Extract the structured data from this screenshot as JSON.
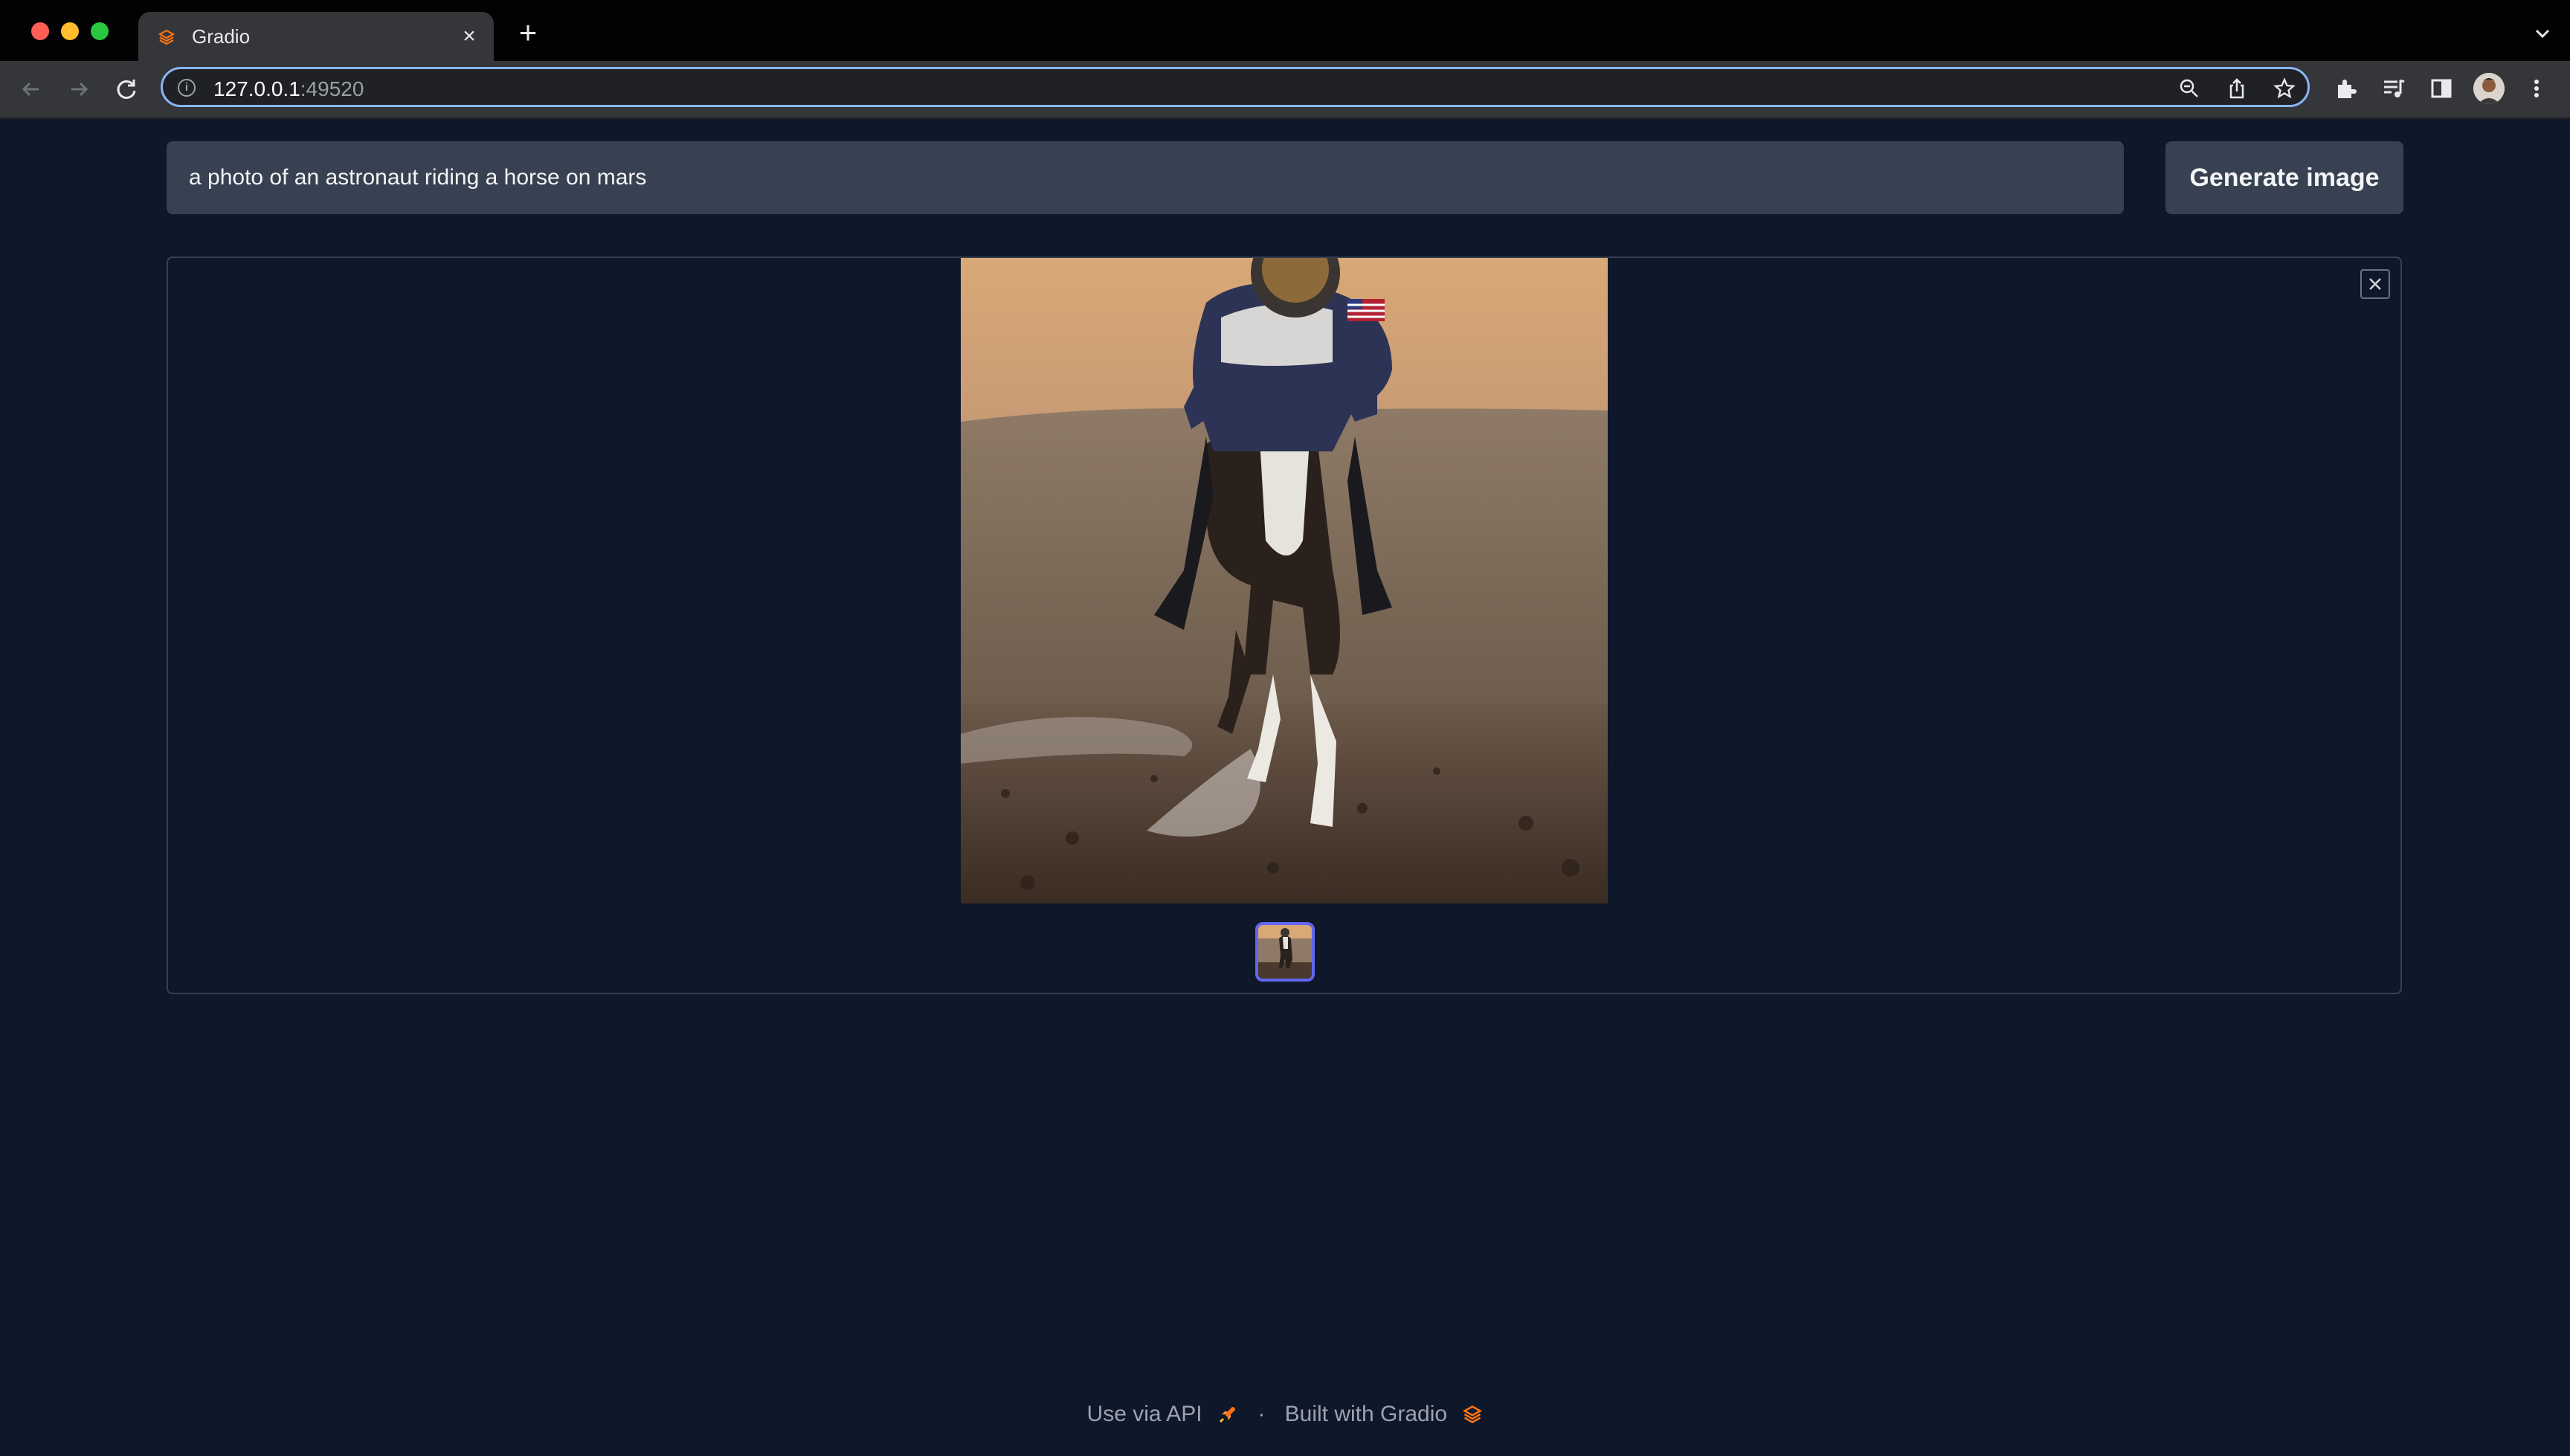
{
  "browser": {
    "tab_title": "Gradio",
    "url_host": "127.0.0.1",
    "url_port": ":49520"
  },
  "app": {
    "prompt_value": "a photo of an astronaut riding a horse on mars",
    "generate_label": "Generate image",
    "gallery": {
      "selected_index": 0,
      "image_count": 1,
      "image_subject": "astronaut riding a horse on mars"
    }
  },
  "footer": {
    "api_label": "Use via API",
    "separator": "·",
    "built_label": "Built with Gradio"
  },
  "colors": {
    "page_bg": "#0f172a",
    "input_bg": "#374151",
    "accent_selected": "#6366f1",
    "gradio_orange": "#f97316"
  },
  "icons": [
    "back-icon",
    "forward-icon",
    "reload-icon",
    "info-icon",
    "zoom-icon",
    "share-icon",
    "star-icon",
    "extensions-icon",
    "media-icon",
    "sidepanel-icon",
    "menu-icon",
    "close-icon",
    "rocket-icon",
    "gradio-logo-icon"
  ]
}
